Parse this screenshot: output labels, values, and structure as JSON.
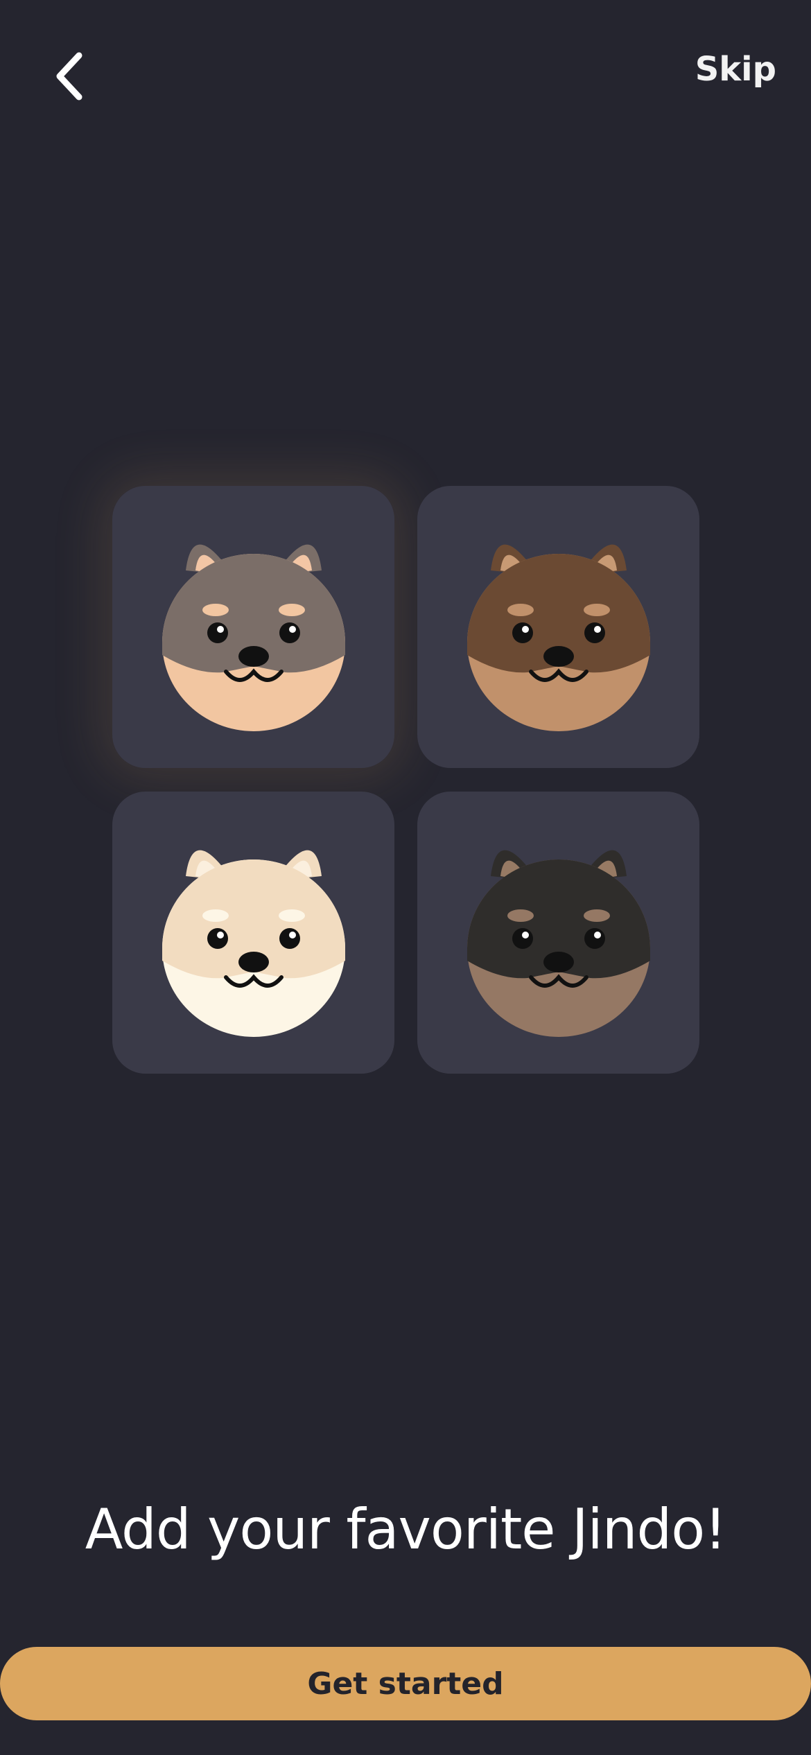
{
  "header": {
    "back_icon": "chevron-left-icon",
    "skip_label": "Skip"
  },
  "avatars": [
    {
      "name": "gray-jindo",
      "fur": "#7b6e68",
      "muzzle": "#f2c6a1",
      "ear_inner": "#f3c6a5",
      "selected": true
    },
    {
      "name": "brown-jindo",
      "fur": "#6b4a33",
      "muzzle": "#c1916b",
      "ear_inner": "#c89a74",
      "selected": false
    },
    {
      "name": "white-jindo",
      "fur": "#f2dcc0",
      "muzzle": "#fdf6e6",
      "ear_inner": "#fbefde",
      "selected": false
    },
    {
      "name": "black-jindo",
      "fur": "#2f2d2b",
      "muzzle": "#957864",
      "ear_inner": "#977a64",
      "selected": false
    }
  ],
  "headline": "Add your favorite Jindo!",
  "cta": {
    "label": "Get started"
  },
  "colors": {
    "background": "#25252f",
    "tile": "#3a3a48",
    "accent": "#dca65f"
  }
}
